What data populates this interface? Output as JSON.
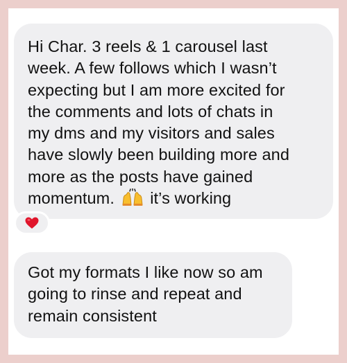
{
  "messages": [
    {
      "text_before_emoji": "Hi Char. 3 reels & 1 carousel last\nweek. A few follows which I wasn’t\nexpecting but I am more excited for\nthe comments and lots of chats in\nmy dms and my visitors and sales\nhave slowly been building more and\nmore as the posts have gained\nmomentum. ",
      "emoji": "raising-hands-emoji",
      "text_after_emoji": " it’s working",
      "reaction": "red-heart-emoji"
    },
    {
      "text": "Got my formats I like now so am\ngoing to rinse and repeat and\nremain consistent"
    }
  ],
  "colors": {
    "frame_border": "#eccfcc",
    "bubble": "#efeff1",
    "text": "#111111",
    "heart": "#e0152b",
    "emoji_yellow": "#f8be2e"
  }
}
